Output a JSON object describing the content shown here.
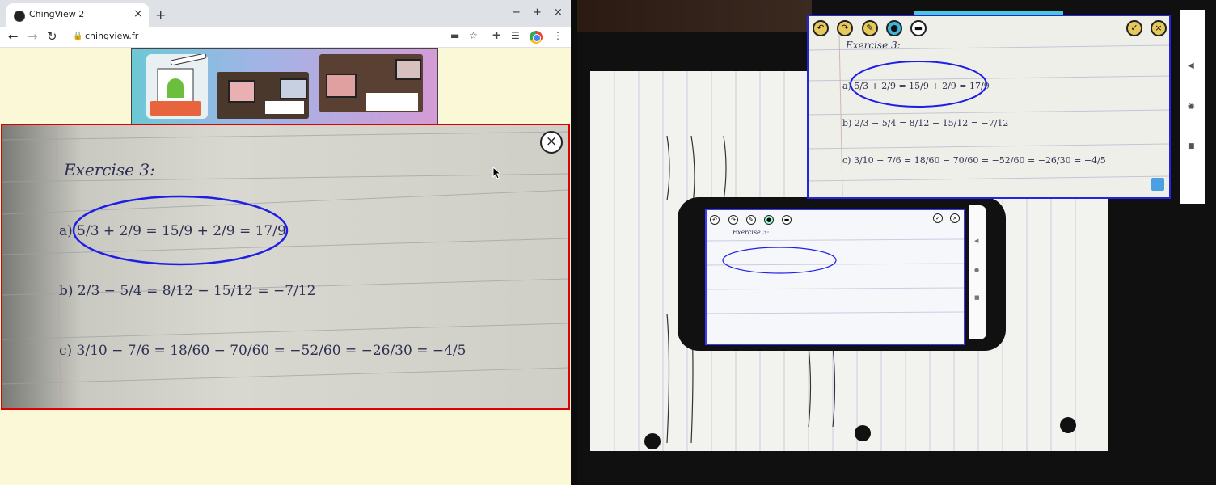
{
  "browser": {
    "tab_title": "ChingView 2",
    "tab_close": "×",
    "new_tab": "+",
    "win_min": "−",
    "win_max": "+",
    "win_close": "×",
    "back": "←",
    "forward": "→",
    "reload": "↻",
    "url": "chingview.fr",
    "lock": "🔒",
    "icons": [
      "cast-icon",
      "star-icon",
      "extensions-icon",
      "media-icon",
      "profile-icon",
      "menu-icon"
    ]
  },
  "doc": {
    "title": "Exercise 3:",
    "line_a": "a) 5/3 + 2/9 = 15/9 + 2/9 = 17/9",
    "line_b": "b) 2/3 − 5/4 = 8/12 − 15/12 = −7/12",
    "line_c": "c) 3/10 − 7/6 = 18/60 − 70/60 = −52/60 = −26/30 = −4/5"
  },
  "viewer": {
    "close": "×"
  },
  "popup": {
    "title": "Exercise 3:",
    "tools": [
      "undo-icon",
      "redo-icon",
      "brush-icon",
      "color-icon",
      "eraser-icon"
    ],
    "confirm": "✓",
    "close": "×"
  },
  "colors": {
    "viewer_border": "#dd0000",
    "popup_border": "#2323e0",
    "annotation": "#1e1ee6",
    "browser_bg": "#fbf8d8"
  }
}
